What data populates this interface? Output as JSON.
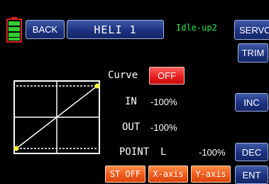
{
  "header": {
    "back_label": "BACK",
    "model_name": "HELI 1",
    "condition": "Idle-up2",
    "servo_label": "SERVO",
    "trim_label": "TRIM"
  },
  "battery": {
    "level": "full",
    "color": "#33cc33"
  },
  "curve": {
    "label": "Curve",
    "state": "OFF",
    "in_label": "IN",
    "in_value": "-100%",
    "out_label": "OUT",
    "out_value": "-100%",
    "point_label": "POINT",
    "point_id": "L",
    "point_value": "-100%"
  },
  "side_buttons": {
    "inc": "INC",
    "dec": "DEC",
    "ent": "ENT"
  },
  "bottom_buttons": {
    "st_off": "ST OFF",
    "x_axis": "X-axis",
    "y_axis": "Y-axis"
  },
  "colors": {
    "accent_blue": "#1d3280",
    "accent_orange": "#f05b1b",
    "off_red": "#e81b1b",
    "mode_green": "#2fe24a",
    "point_yellow": "#f2f23a"
  }
}
